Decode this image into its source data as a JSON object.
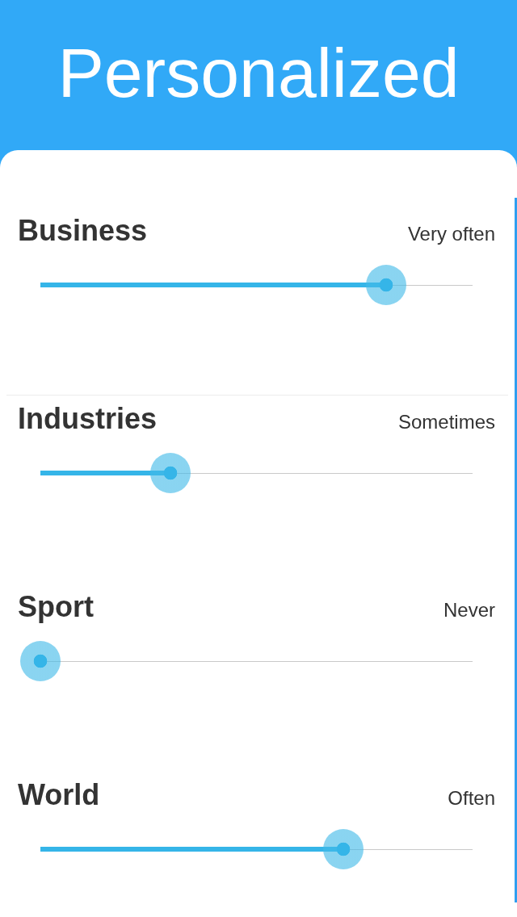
{
  "header": {
    "title": "Personalized"
  },
  "sliders": [
    {
      "label": "Business",
      "reading": "Very often",
      "level": 0.8
    },
    {
      "label": "Industries",
      "reading": "Sometimes",
      "level": 0.3
    },
    {
      "label": "Sport",
      "reading": "Never",
      "level": 0
    },
    {
      "label": "World",
      "reading": "Often",
      "level": 0.7
    }
  ]
}
